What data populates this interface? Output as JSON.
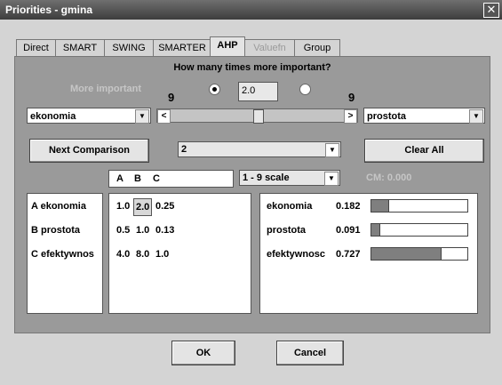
{
  "window": {
    "title": "Priorities - gmina",
    "close_glyph": "✕"
  },
  "tabs": [
    {
      "label": "Direct",
      "active": false,
      "disabled": false
    },
    {
      "label": "SMART",
      "active": false,
      "disabled": false
    },
    {
      "label": "SWING",
      "active": false,
      "disabled": false
    },
    {
      "label": "SMARTER",
      "active": false,
      "disabled": false
    },
    {
      "label": "AHP",
      "active": true,
      "disabled": false
    },
    {
      "label": "Valuefn",
      "active": false,
      "disabled": true
    },
    {
      "label": "Group",
      "active": false,
      "disabled": false
    }
  ],
  "comparison": {
    "question": "How many times more important?",
    "more_important_label": "More important",
    "left_scale_max": "9",
    "right_scale_max": "9",
    "value": "2.0",
    "left_radio_selected": true,
    "right_radio_selected": false,
    "left_criterion": "ekonomia",
    "right_criterion": "prostota",
    "slider_left_glyph": "<",
    "slider_right_glyph": ">",
    "slider_position": 0.5
  },
  "controls": {
    "next_comparison": "Next Comparison",
    "comparison_index": "2",
    "clear_all": "Clear All",
    "scale": "1 - 9 scale",
    "cm": "CM: 0.000",
    "ok": "OK",
    "cancel": "Cancel"
  },
  "matrix": {
    "headers": [
      "A",
      "B",
      "C"
    ],
    "criteria": [
      "A ekonomia",
      "B prostota",
      "C efektywnos"
    ],
    "rows": [
      [
        "1.0",
        "2.0",
        "0.25"
      ],
      [
        "0.5",
        "1.0",
        "0.13"
      ],
      [
        "4.0",
        "8.0",
        "1.0"
      ]
    ],
    "selected": [
      0,
      1
    ]
  },
  "results": [
    {
      "name": "ekonomia",
      "value": "0.182",
      "weight": 0.182
    },
    {
      "name": "prostota",
      "value": "0.091",
      "weight": 0.091
    },
    {
      "name": "efektywnosc",
      "value": "0.727",
      "weight": 0.727
    }
  ],
  "colors": {
    "bar_fill": "#7f7f7f",
    "panel_bg": "#9a9a9a",
    "window_bg": "#d4d4d4"
  }
}
